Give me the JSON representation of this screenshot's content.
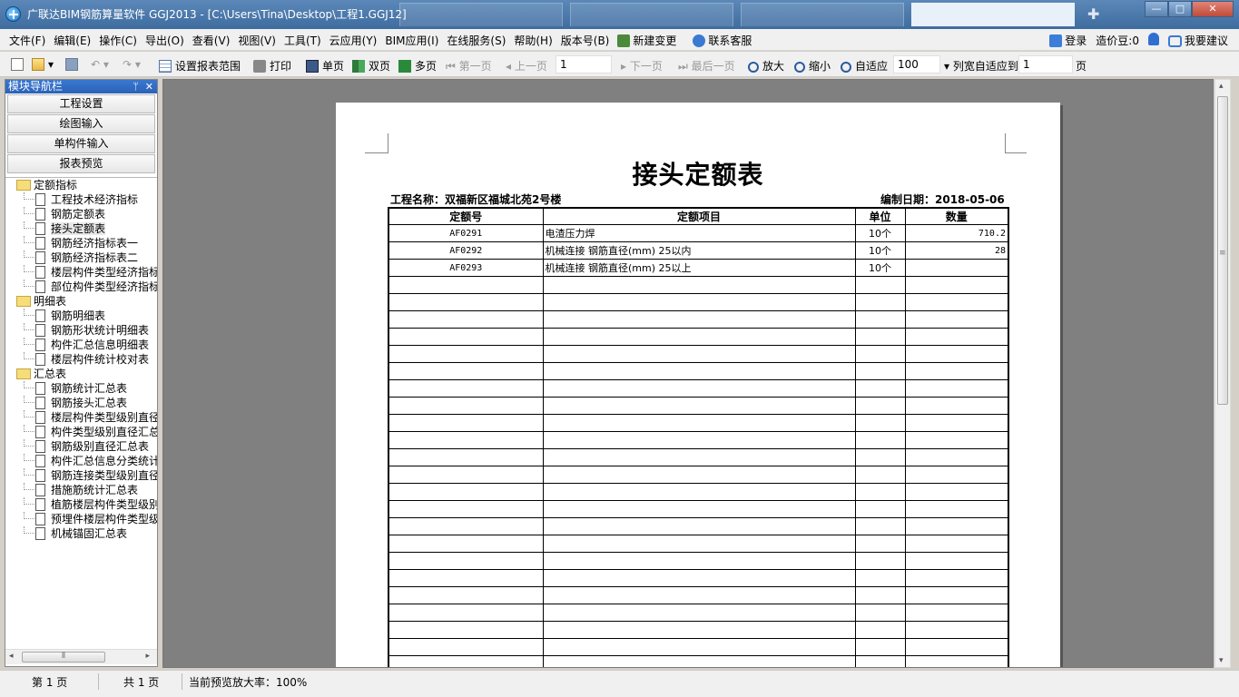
{
  "window": {
    "title": "广联达BIM钢筋算量软件 GGJ2013 - [C:\\Users\\Tina\\Desktop\\工程1.GGJ12]",
    "buttons": {
      "minimize": "—",
      "maximize": "□",
      "close": "✕"
    }
  },
  "menu": {
    "items": [
      "文件(F)",
      "编辑(E)",
      "操作(C)",
      "导出(O)",
      "查看(V)",
      "视图(V)",
      "工具(T)",
      "云应用(Y)",
      "BIM应用(I)",
      "在线服务(S)",
      "帮助(H)",
      "版本号(B)",
      "新建变更",
      "联系客服"
    ],
    "right": {
      "login": "登录",
      "coins": "造价豆:0",
      "suggest": "我要建议"
    }
  },
  "toolbar": {
    "set_range": "设置报表范围",
    "print": "打印",
    "single": "单页",
    "double": "双页",
    "multi": "多页",
    "first": "第一页",
    "prev": "上一页",
    "page_value": "1",
    "next": "下一页",
    "last": "最后一页",
    "zoom_in": "放大",
    "zoom_out": "缩小",
    "fit": "自适应",
    "zoom_value": "100",
    "col_fit": "列宽自适应到",
    "col_value": "1",
    "page_unit": "页"
  },
  "nav": {
    "header": "模块导航栏",
    "buttons": [
      "工程设置",
      "绘图输入",
      "单构件输入",
      "报表预览"
    ],
    "tree": [
      {
        "type": "folder",
        "label": "定额指标"
      },
      {
        "type": "leaf",
        "label": "工程技术经济指标"
      },
      {
        "type": "leaf",
        "label": "钢筋定额表"
      },
      {
        "type": "leaf",
        "label": "接头定额表",
        "selected": true
      },
      {
        "type": "leaf",
        "label": "钢筋经济指标表一"
      },
      {
        "type": "leaf",
        "label": "钢筋经济指标表二"
      },
      {
        "type": "leaf",
        "label": "楼层构件类型经济指标"
      },
      {
        "type": "leaf",
        "label": "部位构件类型经济指标"
      },
      {
        "type": "folder",
        "label": "明细表"
      },
      {
        "type": "leaf",
        "label": "钢筋明细表"
      },
      {
        "type": "leaf",
        "label": "钢筋形状统计明细表"
      },
      {
        "type": "leaf",
        "label": "构件汇总信息明细表"
      },
      {
        "type": "leaf",
        "label": "楼层构件统计校对表"
      },
      {
        "type": "folder",
        "label": "汇总表"
      },
      {
        "type": "leaf",
        "label": "钢筋统计汇总表"
      },
      {
        "type": "leaf",
        "label": "钢筋接头汇总表"
      },
      {
        "type": "leaf",
        "label": "楼层构件类型级别直径"
      },
      {
        "type": "leaf",
        "label": "构件类型级别直径汇总"
      },
      {
        "type": "leaf",
        "label": "钢筋级别直径汇总表"
      },
      {
        "type": "leaf",
        "label": "构件汇总信息分类统计"
      },
      {
        "type": "leaf",
        "label": "钢筋连接类型级别直径"
      },
      {
        "type": "leaf",
        "label": "措施筋统计汇总表"
      },
      {
        "type": "leaf",
        "label": "植筋楼层构件类型级别"
      },
      {
        "type": "leaf",
        "label": "预埋件楼层构件类型级"
      },
      {
        "type": "leaf",
        "label": "机械锚固汇总表"
      }
    ]
  },
  "report": {
    "title": "接头定额表",
    "project_label": "工程名称：双福新区福城北苑2号楼",
    "date_label": "编制日期：2018-05-06",
    "columns": [
      "定额号",
      "定额项目",
      "单位",
      "数量"
    ],
    "rows": [
      [
        "AF0291",
        "电渣压力焊",
        "10个",
        "710.2"
      ],
      [
        "AF0292",
        "机械连接 钢筋直径(mm) 25以内",
        "10个",
        "28"
      ],
      [
        "AF0293",
        "机械连接 钢筋直径(mm) 25以上",
        "10个",
        ""
      ]
    ],
    "empty_rows": 23
  },
  "status": {
    "page": "第 1 页",
    "total": "共 1 页",
    "zoom": "当前预览放大率：100%"
  }
}
